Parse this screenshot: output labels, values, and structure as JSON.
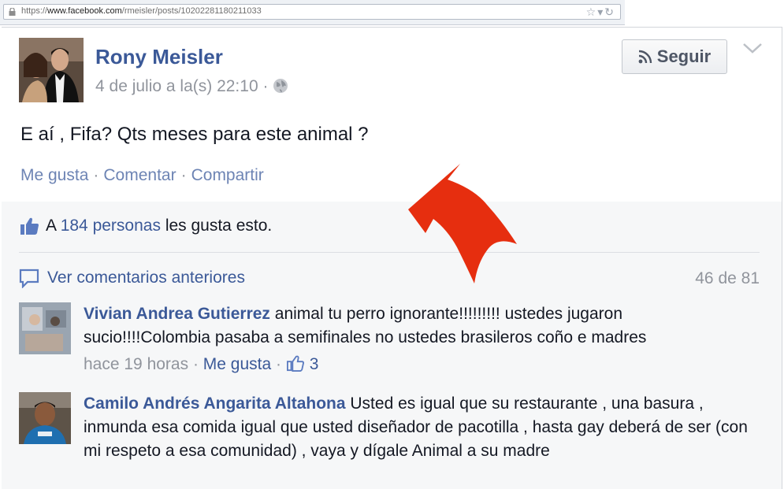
{
  "browser": {
    "url_prefix": "https://",
    "url_domain": "www.facebook.com",
    "url_path": "/rmeisler/posts/10202281180211033"
  },
  "post": {
    "author": "Rony Meisler",
    "timestamp": "4 de julio a la(s) 22:10",
    "meta_separator": "·",
    "follow_label": "Seguir",
    "text": "E aí , Fifa? Qts meses para este animal ?",
    "actions": {
      "like": "Me gusta",
      "sep": "·",
      "comment": "Comentar",
      "share": "Compartir"
    }
  },
  "feedback": {
    "likes_prefix": "A",
    "likes_link": "184 personas",
    "likes_suffix": "les gusta esto.",
    "view_previous": "Ver comentarios anteriores",
    "count": "46 de 81"
  },
  "comments": [
    {
      "name": "Vivian Andrea Gutierrez",
      "text": "animal tu perro ignorante!!!!!!!!! ustedes jugaron sucio!!!!Colombia pasaba a semifinales no ustedes brasileros coño e madres",
      "time": "hace 19 horas",
      "sep": "·",
      "like_label": "Me gusta",
      "like_count": "3"
    },
    {
      "name": "Camilo Andrés Angarita Altahona",
      "text": "Usted es igual que su restaurante , una basura , inmunda esa comida igual que usted diseñador de pacotilla , hasta gay deberá de ser (con mi respeto a esa comunidad) , vaya y dígale Animal a su madre"
    }
  ],
  "colors": {
    "link": "#3b5998",
    "muted": "#90949c",
    "action": "#6d84b4",
    "feedback_bg": "#f6f7f8",
    "arrow": "#e62e0f"
  }
}
